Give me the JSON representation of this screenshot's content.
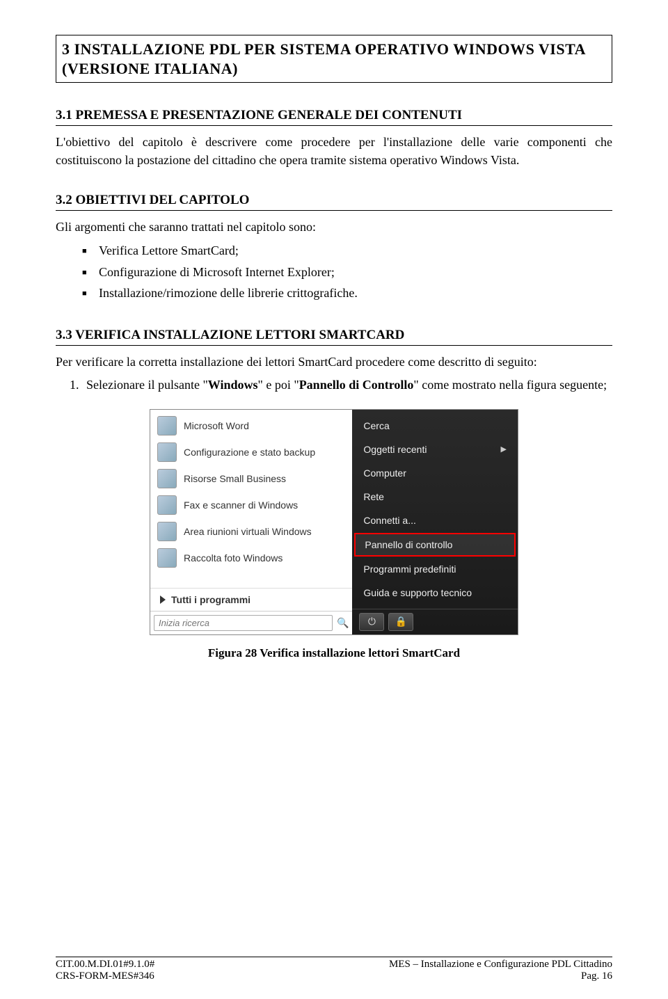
{
  "h1": "3  INSTALLAZIONE PDL PER SISTEMA OPERATIVO WINDOWS VISTA (VERSIONE ITALIANA)",
  "s31": {
    "title": "3.1  PREMESSA E PRESENTAZIONE GENERALE DEI CONTENUTI",
    "p1": "L'obiettivo del capitolo è descrivere come procedere per l'installazione delle varie componenti che costituiscono la postazione del cittadino che opera tramite sistema operativo Windows Vista."
  },
  "s32": {
    "title": "3.2  OBIETTIVI DEL CAPITOLO",
    "intro": "Gli argomenti che saranno trattati nel capitolo sono:",
    "items": [
      "Verifica Lettore  SmartCard;",
      "Configurazione di Microsoft  Internet Explorer;",
      "Installazione/rimozione delle librerie crittografiche."
    ]
  },
  "s33": {
    "title": "3.3  VERIFICA INSTALLAZIONE LETTORI SMARTCARD",
    "p1": "Per verificare la corretta installazione dei lettori SmartCard procedere come descritto di seguito:",
    "step1_a": "Selezionare il pulsante \"",
    "step1_b": "Windows",
    "step1_c": "\" e poi \"",
    "step1_d": "Pannello di Controllo",
    "step1_e": "\" come mostrato nella figura seguente;"
  },
  "startmenu": {
    "left": [
      "Microsoft Word",
      "Configurazione e stato backup",
      "Risorse Small Business",
      "Fax e scanner di Windows",
      "Area riunioni virtuali Windows",
      "Raccolta foto Windows"
    ],
    "all": "Tutti i programmi",
    "search_placeholder": "Inizia ricerca",
    "right": [
      {
        "label": "Cerca",
        "chev": false,
        "hl": false
      },
      {
        "label": "Oggetti recenti",
        "chev": true,
        "hl": false
      },
      {
        "label": "Computer",
        "chev": false,
        "hl": false
      },
      {
        "label": "Rete",
        "chev": false,
        "hl": false
      },
      {
        "label": "Connetti a...",
        "chev": false,
        "hl": false
      },
      {
        "label": "Pannello di controllo",
        "chev": false,
        "hl": true
      },
      {
        "label": "Programmi predefiniti",
        "chev": false,
        "hl": false
      },
      {
        "label": "Guida e supporto tecnico",
        "chev": false,
        "hl": false
      }
    ]
  },
  "caption": "Figura 28 Verifica installazione lettori SmartCard",
  "footer": {
    "l1": "CIT.00.M.DI.01#9.1.0#",
    "l2": "CRS-FORM-MES#346",
    "r1": "MES – Installazione e Configurazione PDL Cittadino",
    "r2": "Pag. 16"
  }
}
